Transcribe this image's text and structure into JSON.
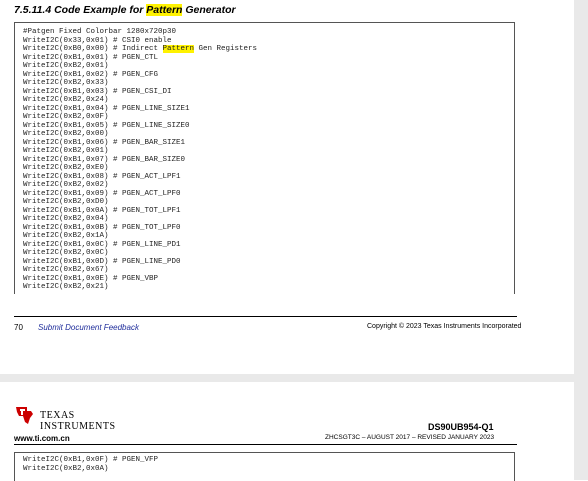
{
  "section": {
    "title_pre": "7.5.11.4 Code Example for ",
    "title_highlight": "Pattern",
    "title_post": " Generator"
  },
  "code_lines": [
    "#Patgen Fixed Colorbar 1280x720p30",
    "WriteI2C(0x33,0x01) # CSI0 enable",
    "WriteI2C(0xB0,0x00) # Indirect ",
    "WriteI2C(0xB1,0x01) # PGEN_CTL",
    "WriteI2C(0xB2,0x01)",
    "WriteI2C(0xB1,0x02) # PGEN_CFG",
    "WriteI2C(0xB2,0x33)",
    "WriteI2C(0xB1,0x03) # PGEN_CSI_DI",
    "WriteI2C(0xB2,0x24)",
    "WriteI2C(0xB1,0x04) # PGEN_LINE_SIZE1",
    "WriteI2C(0xB2,0x0F)",
    "WriteI2C(0xB1,0x05) # PGEN_LINE_SIZE0",
    "WriteI2C(0xB2,0x00)",
    "WriteI2C(0xB1,0x06) # PGEN_BAR_SIZE1",
    "WriteI2C(0xB2,0x01)",
    "WriteI2C(0xB1,0x07) # PGEN_BAR_SIZE0",
    "WriteI2C(0xB2,0xE0)",
    "WriteI2C(0xB1,0x08) # PGEN_ACT_LPF1",
    "WriteI2C(0xB2,0x02)",
    "WriteI2C(0xB1,0x09) # PGEN_ACT_LPF0",
    "WriteI2C(0xB2,0xD0)",
    "WriteI2C(0xB1,0x0A) # PGEN_TOT_LPF1",
    "WriteI2C(0xB2,0x04)",
    "WriteI2C(0xB1,0x0B) # PGEN_TOT_LPF0",
    "WriteI2C(0xB2,0x1A)",
    "WriteI2C(0xB1,0x0C) # PGEN_LINE_PD1",
    "WriteI2C(0xB2,0x0C)",
    "WriteI2C(0xB1,0x0D) # PGEN_LINE_PD0",
    "WriteI2C(0xB2,0x67)",
    "WriteI2C(0xB1,0x0E) # PGEN_VBP",
    "WriteI2C(0xB2,0x21)"
  ],
  "code_line2_highlight": "Pattern",
  "code_line2_post": " Gen Registers",
  "footer": {
    "page_number": "70",
    "feedback_link": "Submit Document Feedback",
    "copyright": "Copyright © 2023 Texas Instruments Incorporated"
  },
  "header": {
    "logo_line1": "TEXAS",
    "logo_line2": "INSTRUMENTS",
    "site": "www.ti.com.cn",
    "part_number": "DS90UB954-Q1",
    "revision": "ZHCSGT3C – AUGUST 2017 – REVISED JANUARY 2023"
  },
  "code_lines_page2": [
    "WriteI2C(0xB1,0x0F) # PGEN_VFP",
    "WriteI2C(0xB2,0x0A)"
  ]
}
